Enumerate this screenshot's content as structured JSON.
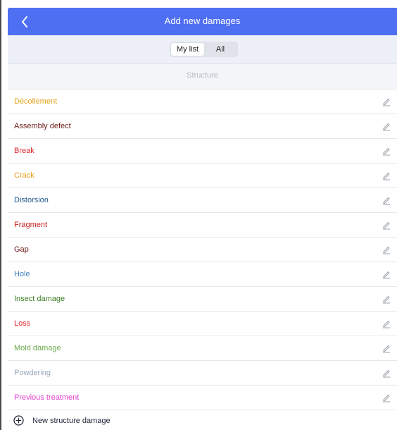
{
  "header": {
    "title": "Add new damages",
    "back_icon": "chevron-left-icon"
  },
  "tabs": {
    "my_list": "My list",
    "all": "All",
    "selected": "My list"
  },
  "section": {
    "label": "Structure"
  },
  "damages": [
    {
      "label": "Décollement",
      "color": "#e3a31a"
    },
    {
      "label": "Assembly defect",
      "color": "#6b1a14"
    },
    {
      "label": "Break",
      "color": "#d8262a"
    },
    {
      "label": "Crack",
      "color": "#ee9f1c"
    },
    {
      "label": "Distorsion",
      "color": "#245a8f"
    },
    {
      "label": "Fragment",
      "color": "#c8221e"
    },
    {
      "label": "Gap",
      "color": "#6a1a15"
    },
    {
      "label": "Hole",
      "color": "#3d7fbf"
    },
    {
      "label": "Insect damage",
      "color": "#3b7d20"
    },
    {
      "label": "Loss",
      "color": "#e2262c"
    },
    {
      "label": "Mold damage",
      "color": "#6caa4a"
    },
    {
      "label": "Powdering",
      "color": "#98a8b8"
    },
    {
      "label": "Previous treatment",
      "color": "#e03fcf"
    }
  ],
  "edit_icon": "pencil-icon",
  "add_new": {
    "label": "New structure damage",
    "icon": "plus-circle-icon"
  },
  "colors": {
    "header_bg": "#4f6ff2",
    "tabs_bg": "#edf1f7",
    "section_bg": "#f3f5f9"
  }
}
